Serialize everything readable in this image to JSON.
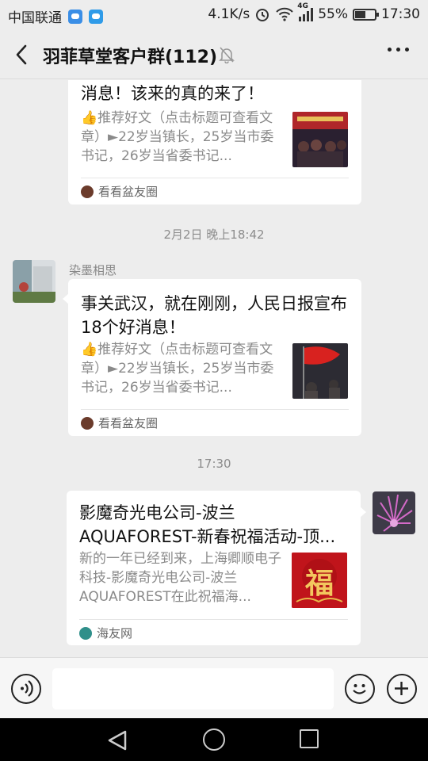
{
  "status_bar": {
    "carrier": "中国联通",
    "speed": "4.1K/s",
    "network_tag": "4G",
    "battery": "55%",
    "battery_level": 0.55,
    "time": "17:30"
  },
  "header": {
    "title": "羽菲草堂客户群(112)"
  },
  "messages": {
    "msg1": {
      "title": "消息！该来的真的来了！",
      "desc": "👍推荐好文（点击标题可查看文章）►22岁当镇长，25岁当市委书记，26岁当省委书记...",
      "source": "看看盆友圈"
    },
    "time1": "2月2日 晚上18:42",
    "msg2": {
      "sender": "染墨相思",
      "title": "事关武汉，就在刚刚，人民日报宣布18个好消息！",
      "desc": "👍推荐好文（点击标题可查看文章）►22岁当镇长，25岁当市委书记，26岁当省委书记...",
      "source": "看看盆友圈"
    },
    "time2": "17:30",
    "msg3": {
      "title_line1": "影魔奇光电公司-波兰",
      "title_line2": "AQUAFOREST-新春祝福活动-顶...",
      "desc": "新的一年已经到来，上海卿顺电子科技-影魔奇光电公司-波兰AQUAFOREST在此祝福海...",
      "source": "海友网",
      "thumb_char": "福"
    }
  }
}
